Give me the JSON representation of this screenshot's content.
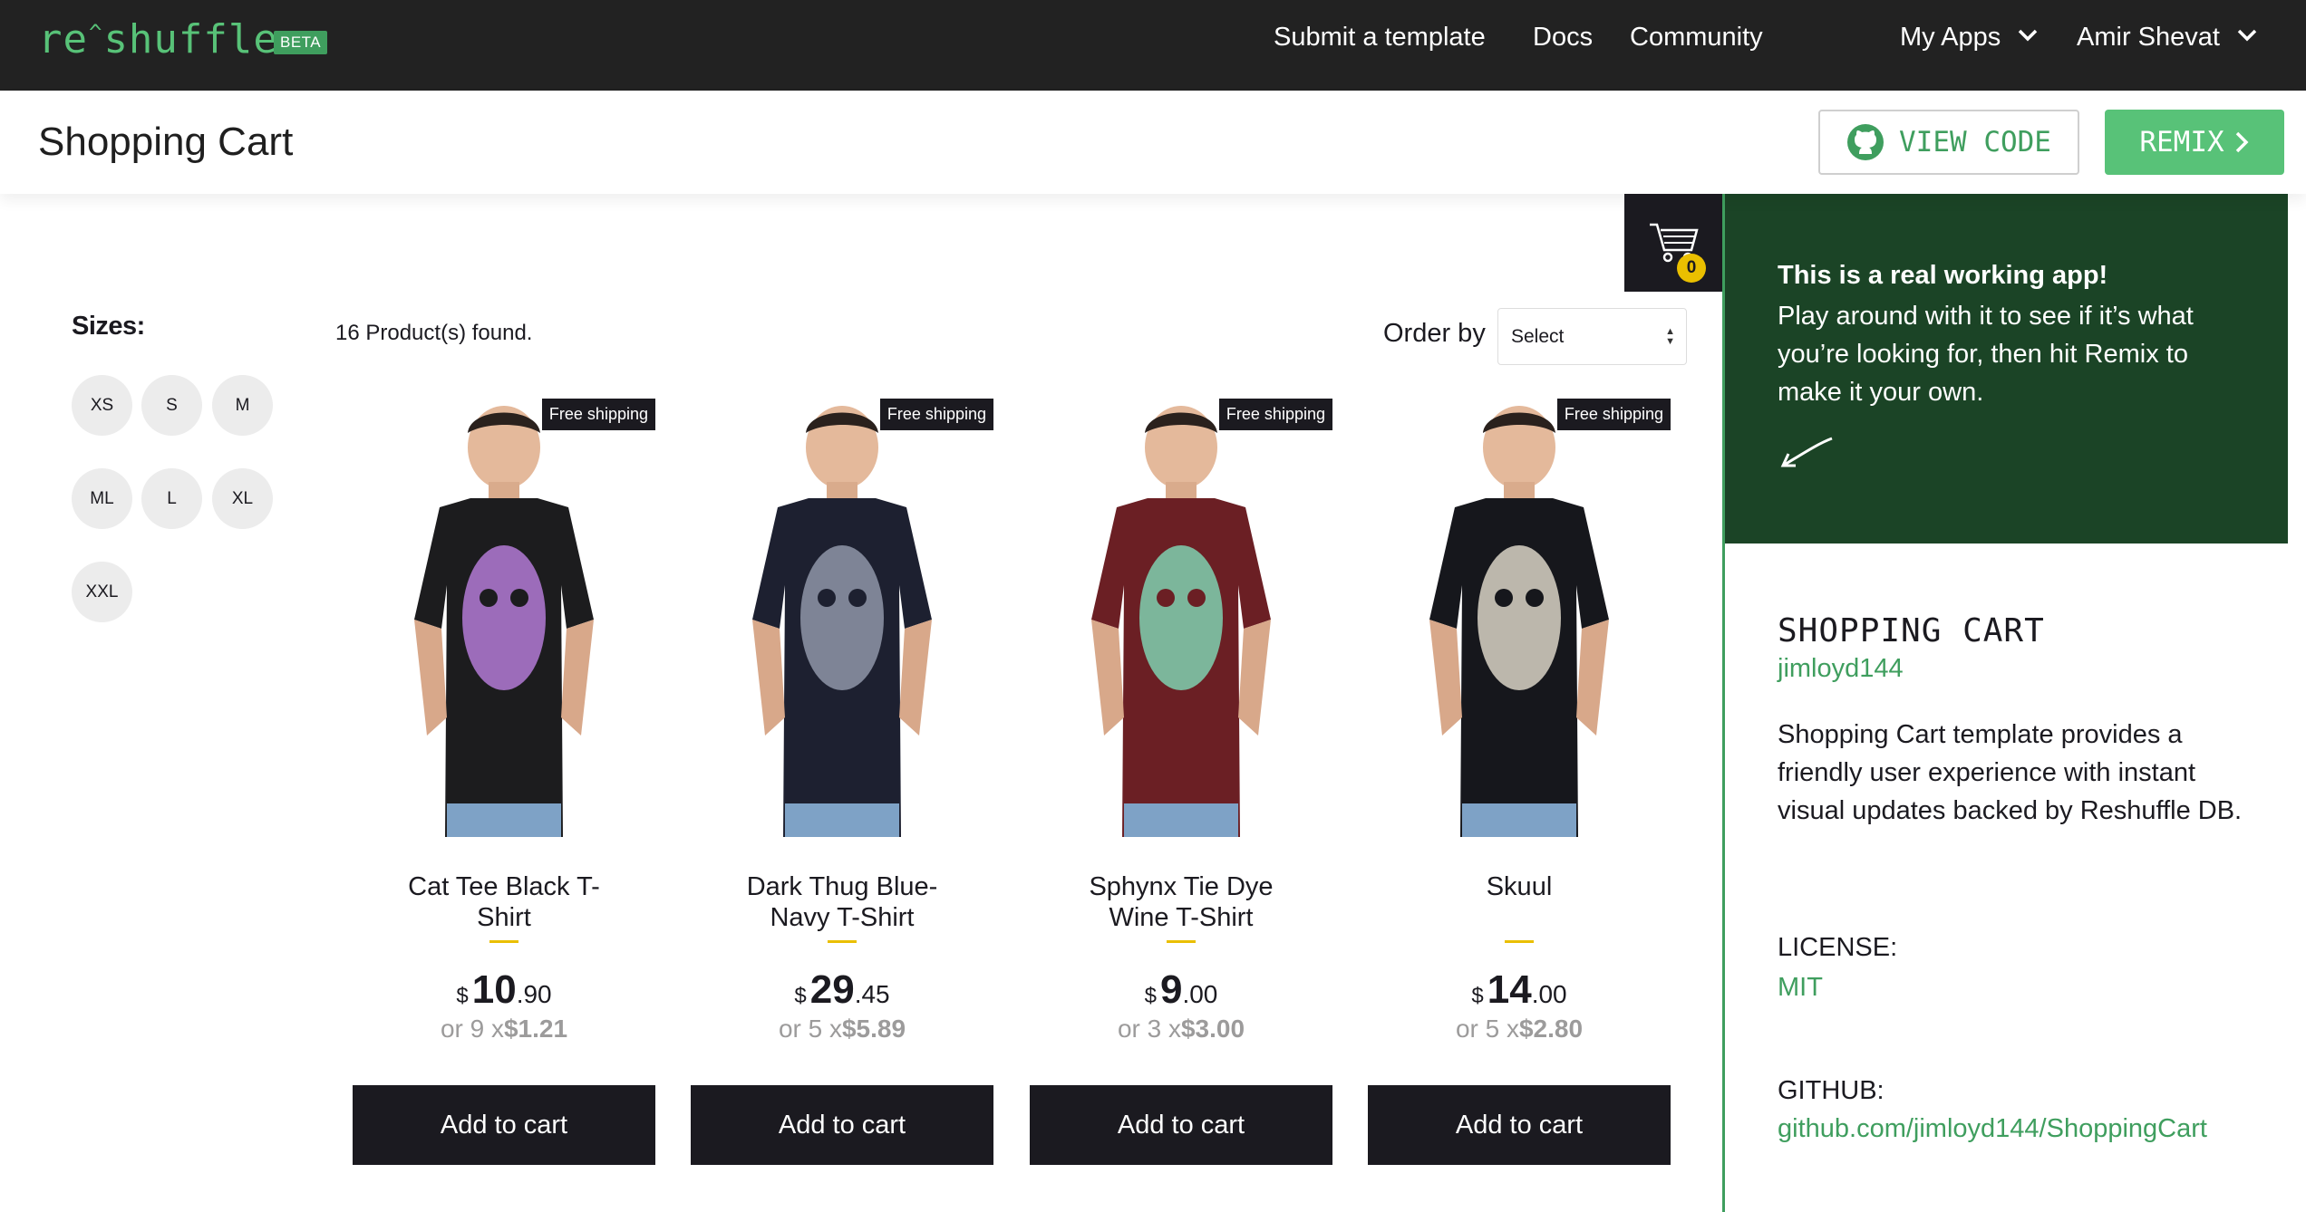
{
  "brand": {
    "name_start": "re",
    "caret": "^",
    "name_end": "shuffle",
    "badge": "BETA"
  },
  "nav": {
    "submit": "Submit a template",
    "docs": "Docs",
    "community": "Community",
    "my_apps": "My Apps",
    "user": "Amir Shevat"
  },
  "header": {
    "title": "Shopping Cart",
    "view_code": "VIEW CODE",
    "remix": "REMIX"
  },
  "cart": {
    "count": "0"
  },
  "filters": {
    "title": "Sizes:",
    "sizes": [
      "XS",
      "S",
      "M",
      "ML",
      "L",
      "XL",
      "XXL"
    ]
  },
  "shelf": {
    "found": "16 Product(s) found.",
    "order_label": "Order by",
    "order_value": "Select"
  },
  "products": [
    {
      "title_l1": "Cat Tee Black T-",
      "title_l2": "Shirt",
      "currency": "$",
      "int": "10",
      "dec": ".90",
      "inst_prefix": "or 9 x",
      "inst_value": "$1.21",
      "badge": "Free shipping",
      "button": "Add to cart",
      "shirt_color": "#1c1c1e",
      "print_color": "#b37ad6"
    },
    {
      "title_l1": "Dark Thug Blue-",
      "title_l2": "Navy T-Shirt",
      "currency": "$",
      "int": "29",
      "dec": ".45",
      "inst_prefix": "or 5 x",
      "inst_value": "$5.89",
      "badge": "Free shipping",
      "button": "Add to cart",
      "shirt_color": "#1d2030",
      "print_color": "#8f96a8"
    },
    {
      "title_l1": "Sphynx Tie Dye",
      "title_l2": "Wine T-Shirt",
      "currency": "$",
      "int": "9",
      "dec": ".00",
      "inst_prefix": "or 3 x",
      "inst_value": "$3.00",
      "badge": "Free shipping",
      "button": "Add to cart",
      "shirt_color": "#6b1f24",
      "print_color": "#7fd1b0"
    },
    {
      "title_l1": "Skuul",
      "title_l2": "",
      "currency": "$",
      "int": "14",
      "dec": ".00",
      "inst_prefix": "or 5 x",
      "inst_value": "$2.80",
      "badge": "Free shipping",
      "button": "Add to cart",
      "shirt_color": "#16171c",
      "print_color": "#d9d4c6"
    }
  ],
  "promo": {
    "bold": "This is a real working app!",
    "text": "Play around with it to see if it’s what you’re looking for, then hit Remix to make it your own."
  },
  "info": {
    "title": "SHOPPING CART",
    "author": "jimloyd144",
    "description": "Shopping Cart template provides a friendly user experience with instant visual updates backed by Reshuffle DB.",
    "license_label": "LICENSE:",
    "license": "MIT",
    "github_label": "GITHUB:",
    "github": "github.com/jimloyd144/ShoppingCart"
  },
  "colors": {
    "brand_green": "#58c278",
    "dark_green": "#1b4426",
    "accent_yellow": "#eabf00",
    "ink": "#1b1a20"
  }
}
